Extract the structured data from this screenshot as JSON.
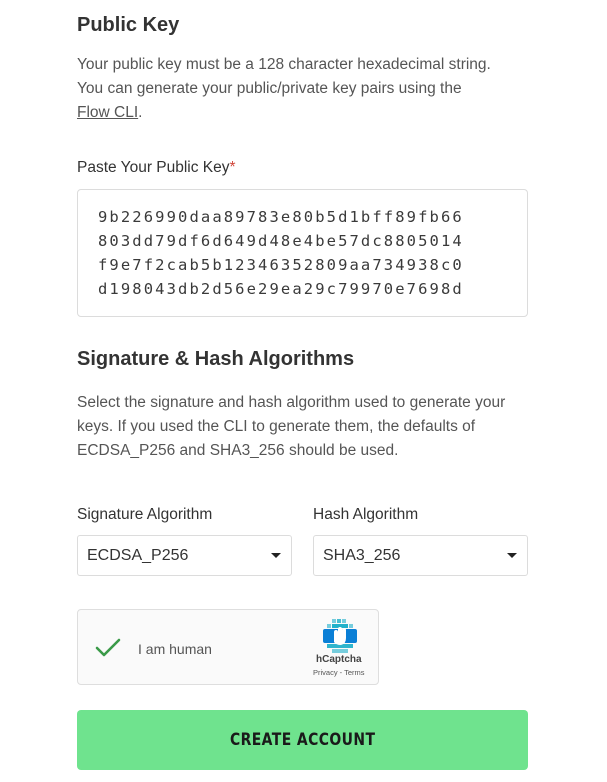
{
  "public_key": {
    "title": "Public Key",
    "description_line1": "Your public key must be a 128 character hexadecimal string.",
    "description_line2": "You can generate your public/private key pairs using the",
    "flow_cli_link": "Flow CLI",
    "description_end": ".",
    "field_label": "Paste Your Public Key",
    "required_marker": "*",
    "key_lines": [
      "9b226990daa89783e80b5d1bff89fb66",
      "803dd79df6d649d48e4be57dc8805014",
      "f9e7f2cab5b12346352809aa734938c0",
      "d198043db2d56e29ea29c79970e7698d"
    ]
  },
  "algorithms": {
    "title": "Signature & Hash Algorithms",
    "description_line1": "Select the signature and hash algorithm used to generate your",
    "description_line2": "keys. If you used the CLI to generate them, the defaults of",
    "description_line3": "ECDSA_P256 and SHA3_256 should be used.",
    "signature_label": "Signature Algorithm",
    "signature_value": "ECDSA_P256",
    "hash_label": "Hash Algorithm",
    "hash_value": "SHA3_256"
  },
  "captcha": {
    "label": "I am human",
    "brand": "hCaptcha",
    "links": "Privacy - Terms",
    "check_color": "#3a9a48"
  },
  "submit": {
    "label": "CREATE ACCOUNT",
    "color": "#6fe38e"
  }
}
